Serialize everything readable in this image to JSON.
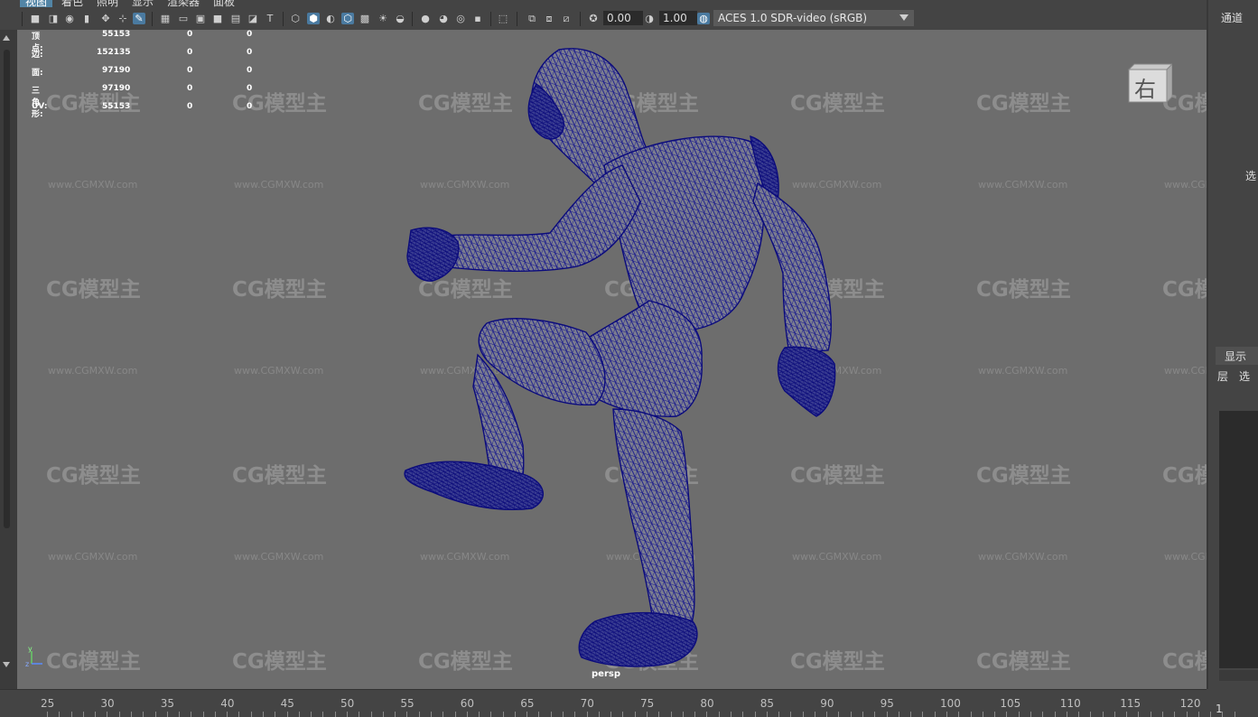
{
  "menu": {
    "items": [
      "视图",
      "着色",
      "照明",
      "显示",
      "渲染器",
      "面板"
    ]
  },
  "toolbar": {
    "exposure_value": "0.00",
    "gamma_value": "1.00",
    "color_management": "ACES 1.0 SDR-video (sRGB)",
    "icons": [
      "camera-icon",
      "camera-attributes-icon",
      "bookmark-icon",
      "image-plane-icon",
      "2d-pan-icon",
      "grease-pencil-icon",
      "grid-icon",
      "film-gate-icon",
      "resolution-gate-icon",
      "gate-mask-icon",
      "field-chart-icon",
      "safe-action-icon",
      "safe-title-icon",
      "wireframe-icon",
      "smooth-shade-icon",
      "default-material-icon",
      "wireframe-on-shaded-icon",
      "textured-icon",
      "use-lights-icon",
      "shadows-icon",
      "screen-space-ao-icon",
      "motion-blur-icon",
      "anti-aliasing-icon",
      "depth-of-field-icon",
      "isolate-select-icon",
      "xray-icon",
      "xray-joints-icon",
      "xray-components-icon",
      "exposure-icon",
      "gamma-icon",
      "color-management-icon"
    ]
  },
  "hud": {
    "rows": [
      {
        "label": "顶点:",
        "value": "55153",
        "v2": "0",
        "v3": "0"
      },
      {
        "label": "边:",
        "value": "152135",
        "v2": "0",
        "v3": "0"
      },
      {
        "label": "面:",
        "value": "97190",
        "v2": "0",
        "v3": "0"
      },
      {
        "label": "三角形:",
        "value": "97190",
        "v2": "0",
        "v3": "0"
      },
      {
        "label": "UV:",
        "value": "55153",
        "v2": "0",
        "v3": "0"
      }
    ]
  },
  "viewport": {
    "camera": "persp",
    "viewcube_label": "右",
    "watermark_logo": "CG模型主",
    "watermark_url": "www.CGMXW.com",
    "axis_labels": [
      "y",
      "z"
    ],
    "mesh_color": "#0a0a8a"
  },
  "right_panel": {
    "channels_tab": "通道",
    "select_label": "选",
    "display_tab": "显示",
    "layer_label": "层",
    "layer_option": "选",
    "bottom_number": "1"
  },
  "timeline": {
    "ticks": [
      "25",
      "30",
      "35",
      "40",
      "45",
      "50",
      "55",
      "60",
      "65",
      "70",
      "75",
      "80",
      "85",
      "90",
      "95",
      "100",
      "105",
      "110",
      "115",
      "120"
    ]
  }
}
